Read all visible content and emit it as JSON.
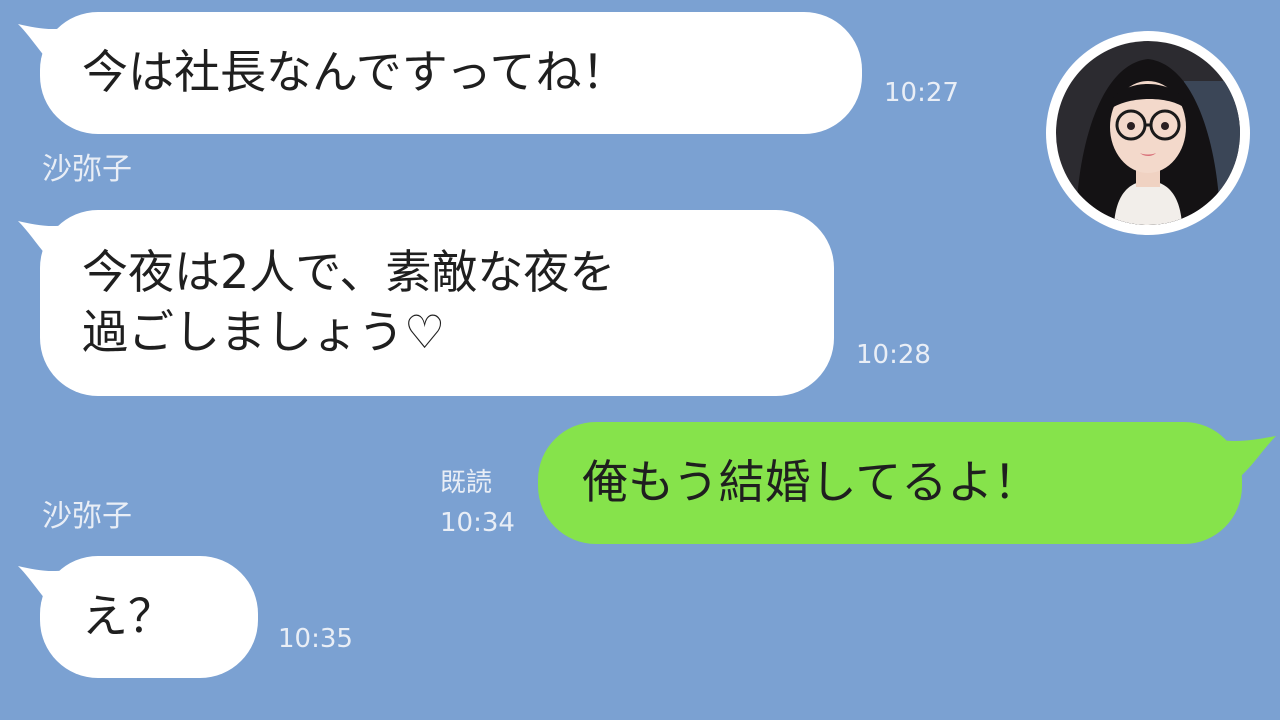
{
  "chat": {
    "sender_name": "沙弥子",
    "messages": [
      {
        "direction": "incoming",
        "text": "今は社長なんですってね！",
        "time": "10:27"
      },
      {
        "direction": "incoming",
        "text": "今夜は2人で、素敵な夜を\n過ごしましょう♡",
        "time": "10:28"
      },
      {
        "direction": "outgoing",
        "text": "俺もう結婚してるよ！",
        "read_label": "既読",
        "time": "10:34"
      },
      {
        "direction": "incoming",
        "text": "え？",
        "time": "10:35"
      }
    ]
  },
  "colors": {
    "background": "#7ba1d2",
    "incoming_bubble": "#ffffff",
    "outgoing_bubble": "#86e34b"
  },
  "avatar": {
    "icon": "woman-with-glasses-avatar"
  }
}
